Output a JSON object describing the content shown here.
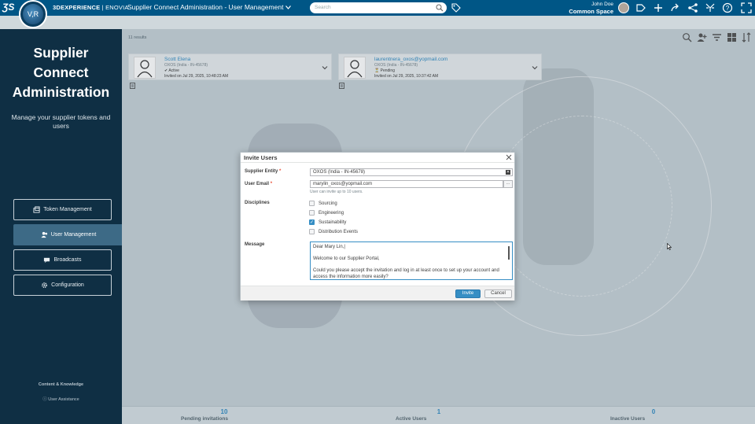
{
  "topbar": {
    "brand_bold": "3DEXPERIENCE",
    "brand_sep": " | ",
    "brand_app": "ENOVIA",
    "app_title": "Supplier Connect Administration - User Management",
    "compass_label": "V,R",
    "search_placeholder": "Search",
    "user_name": "John Doe",
    "space_name": "Common Space"
  },
  "sidebar": {
    "title_lines": [
      "Supplier",
      "Connect",
      "Administration"
    ],
    "subtitle": "Manage your supplier tokens and users",
    "nav": [
      {
        "label": "Token Management",
        "icon": "token-icon"
      },
      {
        "label": "User Management",
        "icon": "users-icon",
        "active": true
      },
      {
        "label": "Broadcasts",
        "icon": "broadcast-icon"
      },
      {
        "label": "Configuration",
        "icon": "gear-icon"
      }
    ],
    "content_knowledge": "Content & Knowledge",
    "user_assistance": "User Assistance"
  },
  "main": {
    "results": "11 results",
    "cards": [
      {
        "name": "Scott Elena",
        "entity": "OXOS (India - IN-45678)",
        "status": "Active",
        "status_glyph": "✔",
        "invited": "Invited on Jul 29, 2025, 10:48:23 AM"
      },
      {
        "name": "laurentnera_oxos@yopmail.com",
        "entity": "OXOS (India - IN-45678)",
        "status": "Pending",
        "status_glyph": "⏳",
        "invited": "Invited on Jul 29, 2025, 10:37:42 AM"
      }
    ],
    "stats": [
      {
        "num": "10",
        "label": "Pending invitations"
      },
      {
        "num": "1",
        "label": "Active Users"
      },
      {
        "num": "0",
        "label": "Inactive Users"
      }
    ]
  },
  "dialog": {
    "title": "Invite Users",
    "supplier_entity_label": "Supplier Entity",
    "supplier_entity_value": "OXOS (India - IN-45678)",
    "user_email_label": "User Email",
    "user_email_value": "marylin_oxos@yopmail.com",
    "email_hint": "User can invite up to 10 users.",
    "disciplines_label": "Disciplines",
    "disciplines": [
      {
        "label": "Sourcing",
        "checked": false
      },
      {
        "label": "Engineering",
        "checked": false
      },
      {
        "label": "Sustainability",
        "checked": true
      },
      {
        "label": "Distribution Events",
        "checked": false
      }
    ],
    "message_label": "Message",
    "message_lines": [
      "Dear Mary Lin,|",
      "Welcome to our Supplier Portal,",
      "Could you please accept the invitation and log in at least once to set up your account and access the information more easily?"
    ],
    "invite_label": "Invite",
    "cancel_label": "Cancel",
    "required_mark": "*",
    "more_glyph": "...",
    "clear_glyph": "✕"
  },
  "colors": {
    "topbar": "#005686",
    "sidebar": "#0f2f44",
    "accent": "#368ec4",
    "required": "#ea4f37"
  }
}
